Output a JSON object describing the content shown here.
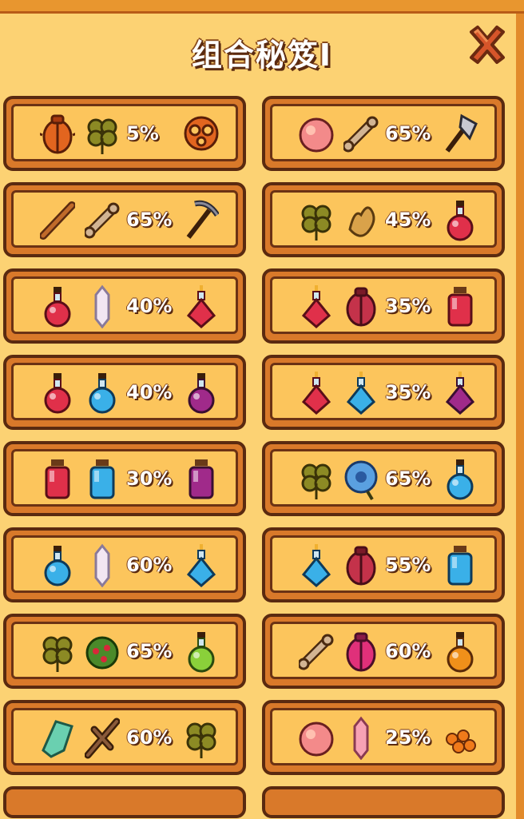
{
  "title": "组合秘笈I",
  "close_icon": "close-x-icon",
  "colors": {
    "panel": "#fcd273",
    "card_outer": "#d9792a",
    "card_inner": "#fcc55c",
    "border_dark": "#5a2a10",
    "text": "#ffffff"
  },
  "recipes": [
    {
      "a": "beetle-icon",
      "b": "clover-icon",
      "chance": "5%",
      "result": "pretzel-icon"
    },
    {
      "a": "peach-icon",
      "b": "bone-icon",
      "chance": "65%",
      "result": "axe-icon"
    },
    {
      "a": "stick-icon",
      "b": "bone-icon",
      "chance": "65%",
      "result": "pickaxe-icon"
    },
    {
      "a": "clover-icon",
      "b": "ginger-root-icon",
      "chance": "45%",
      "result": "red-potion-icon"
    },
    {
      "a": "red-potion-icon",
      "b": "crystal-icon",
      "chance": "40%",
      "result": "red-flask-icon"
    },
    {
      "a": "red-flask-icon",
      "b": "red-beetle-icon",
      "chance": "35%",
      "result": "red-bottle-icon"
    },
    {
      "a": "red-potion-icon",
      "b": "blue-potion-icon",
      "chance": "40%",
      "result": "purple-potion-icon"
    },
    {
      "a": "red-flask-icon",
      "b": "blue-flask-icon",
      "chance": "35%",
      "result": "purple-flask-icon"
    },
    {
      "a": "red-bottle-icon",
      "b": "blue-bottle-icon",
      "chance": "30%",
      "result": "purple-bottle-icon"
    },
    {
      "a": "clover-icon",
      "b": "blue-flower-icon",
      "chance": "65%",
      "result": "blue-potion-icon"
    },
    {
      "a": "blue-potion-icon",
      "b": "crystal-icon",
      "chance": "60%",
      "result": "blue-flask-icon"
    },
    {
      "a": "blue-flask-icon",
      "b": "red-beetle-icon",
      "chance": "55%",
      "result": "blue-bottle-icon"
    },
    {
      "a": "clover-icon",
      "b": "berry-bush-icon",
      "chance": "65%",
      "result": "green-potion-icon"
    },
    {
      "a": "bone-icon",
      "b": "pink-beetle-icon",
      "chance": "60%",
      "result": "orange-potion-icon"
    },
    {
      "a": "green-crystal-icon",
      "b": "twig-icon",
      "chance": "60%",
      "result": "clover-icon"
    },
    {
      "a": "peach-icon",
      "b": "pink-crystal-icon",
      "chance": "25%",
      "result": "orange-eggs-icon"
    }
  ]
}
